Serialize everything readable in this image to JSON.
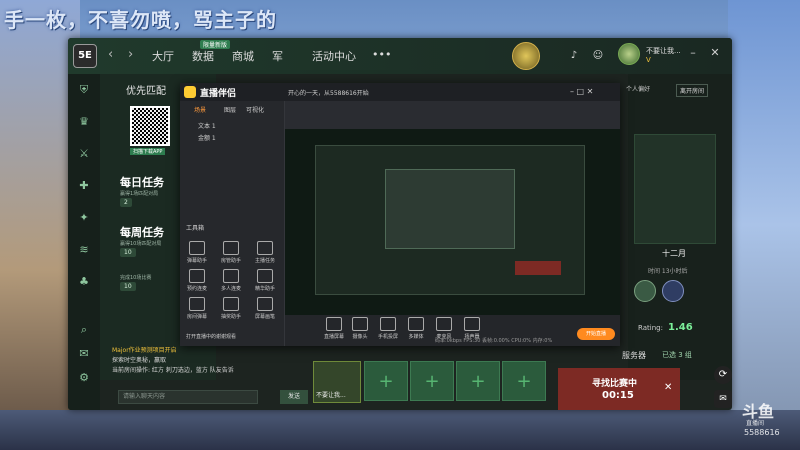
{
  "overlay": {
    "banner": "手一枚，不喜勿喷，骂主子的"
  },
  "launcher": {
    "logo": "5E",
    "nav": [
      "大厅",
      "数据",
      "商城",
      "军",
      "活动中心"
    ],
    "nav_badge": "限量新版",
    "more": "•••",
    "user_name": "不要让我...",
    "user_level": "V",
    "leave_room": "离开房间",
    "personal_pref": "个人偏好"
  },
  "left_col": {
    "tab": "优先匹配",
    "qr_caption": "扫描下载APP",
    "daily_task": {
      "title": "每日任务",
      "sub": "赢得1场匹配对局",
      "reward": "2"
    },
    "weekly_task": {
      "title": "每周任务",
      "sub": "赢得10场匹配对局",
      "reward": "10"
    },
    "third_task": {
      "sub": "完成10场比赛",
      "reward": "10"
    }
  },
  "chat": {
    "line1": "Major作业预测项目开启",
    "line2": "探索时空奥秘，赢取",
    "line3": "当前房间操作: 红方 刺刀选边，蓝方 队友告诉",
    "input_placeholder": "请输入聊天内容",
    "send_label": "发送"
  },
  "right_panel": {
    "month": "十二月",
    "time": "时间 13小时后",
    "rating_label": "Rating:",
    "rating_value": "1.46",
    "server_label": "服务器",
    "server_value": "已选 3 组"
  },
  "matching": {
    "title": "寻找比赛中",
    "time": "00:15"
  },
  "player_card": {
    "name": "不要让我..."
  },
  "stream_app": {
    "title": "直播伴侣",
    "tabs": [
      "场景",
      "图层",
      "可视化"
    ],
    "room_title": "开心的一天，从5588616开始",
    "game_tag": "CS:GO - 万博陪玩",
    "id_label": "ID 5588616",
    "sources": [
      "文本 1",
      "金额 1"
    ],
    "tools_label": "工具箱",
    "tools": [
      "弹幕助手",
      "房管助手",
      "主播任务",
      "预约连麦",
      "多人连麦",
      "精华助手",
      "房间弹幕",
      "抽奖助手",
      "屏幕画笔"
    ],
    "bottom_notice": "打开直播中的谢谢观看",
    "bar_tools": [
      "直播屏幕",
      "摄像头",
      "手机投屏",
      "多媒体",
      "麦克风",
      "扬声器"
    ],
    "stats": [
      "码率:0kbps",
      "FPS:30",
      "丢帧:0.00%",
      "CPU:0%",
      "内存:0%"
    ],
    "start_label": "开始直播"
  },
  "watermark": {
    "brand": "斗鱼",
    "sub": "直播间",
    "room": "5588616"
  },
  "colors": {
    "accent_green": "#2e7d4f",
    "match_red": "#7d2a24",
    "start_orange": "#ff8a1f"
  }
}
